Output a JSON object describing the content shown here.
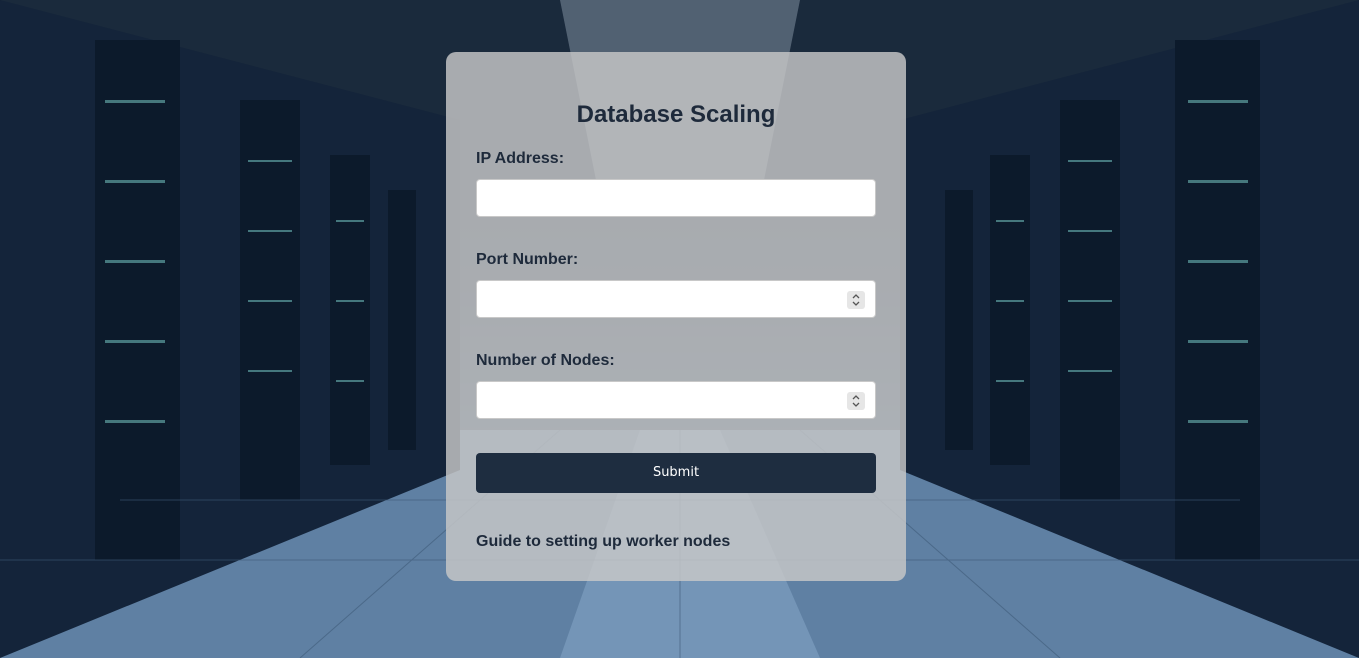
{
  "form": {
    "title": "Database Scaling",
    "ip_label": "IP Address:",
    "ip_value": "",
    "port_label": "Port Number:",
    "port_value": "",
    "nodes_label": "Number of Nodes:",
    "nodes_value": "",
    "submit_label": "Submit",
    "guide_link": "Guide to setting up worker nodes"
  },
  "colors": {
    "text": "#1e2a3b",
    "button": "#1e2d40",
    "card": "#c8c8c8"
  },
  "icons": {
    "background": "server-room-background",
    "stepper": "number-stepper-icon"
  }
}
